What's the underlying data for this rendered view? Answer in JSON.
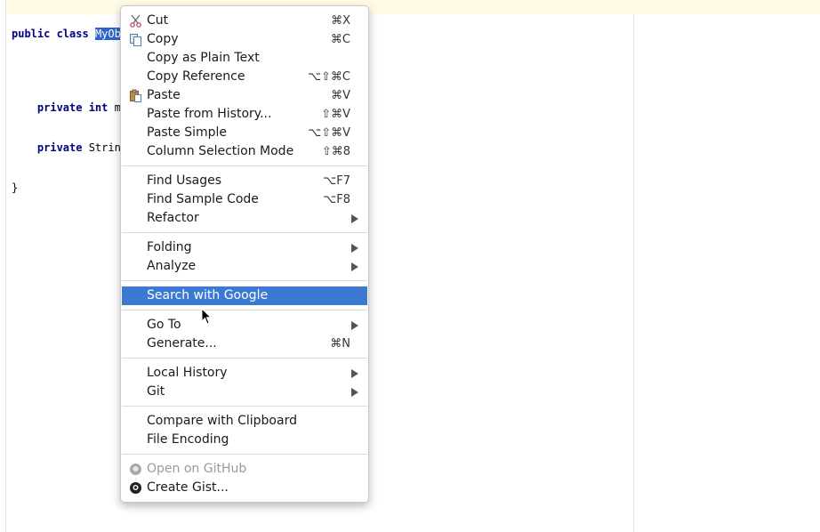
{
  "editor": {
    "lines": {
      "l1": {
        "kw": "public class",
        "selected": "MyObject",
        "rest": " {"
      },
      "l2": {
        "kw": "private int",
        "rest": " my"
      },
      "l3": {
        "kw": "private",
        "rest": " String"
      },
      "l4": {
        "text": "}"
      }
    }
  },
  "menu": {
    "items": [
      {
        "label": "Cut",
        "shortcut": "⌘X",
        "icon": "scissors-icon"
      },
      {
        "label": "Copy",
        "shortcut": "⌘C",
        "icon": "copy-icon"
      },
      {
        "label": "Copy as Plain Text",
        "shortcut": ""
      },
      {
        "label": "Copy Reference",
        "shortcut": "⌥⇧⌘C"
      },
      {
        "label": "Paste",
        "shortcut": "⌘V",
        "icon": "clipboard-icon"
      },
      {
        "label": "Paste from History...",
        "shortcut": "⇧⌘V"
      },
      {
        "label": "Paste Simple",
        "shortcut": "⌥⇧⌘V"
      },
      {
        "label": "Column Selection Mode",
        "shortcut": "⇧⌘8"
      },
      {
        "label": "Find Usages",
        "shortcut": "⌥F7"
      },
      {
        "label": "Find Sample Code",
        "shortcut": "⌥F8"
      },
      {
        "label": "Refactor",
        "submenu": true
      },
      {
        "label": "Folding",
        "submenu": true
      },
      {
        "label": "Analyze",
        "submenu": true
      },
      {
        "label": "Search with Google",
        "highlighted": true
      },
      {
        "label": "Go To",
        "submenu": true
      },
      {
        "label": "Generate...",
        "shortcut": "⌘N"
      },
      {
        "label": "Local History",
        "submenu": true
      },
      {
        "label": "Git",
        "submenu": true
      },
      {
        "label": "Compare with Clipboard"
      },
      {
        "label": "File Encoding"
      },
      {
        "label": "Open on GitHub",
        "disabled": true,
        "icon": "github-icon"
      },
      {
        "label": "Create Gist...",
        "icon": "github-icon"
      }
    ]
  },
  "colors": {
    "highlight": "#3b79d3",
    "selection": "#2f65ca",
    "keyword": "#000080"
  }
}
